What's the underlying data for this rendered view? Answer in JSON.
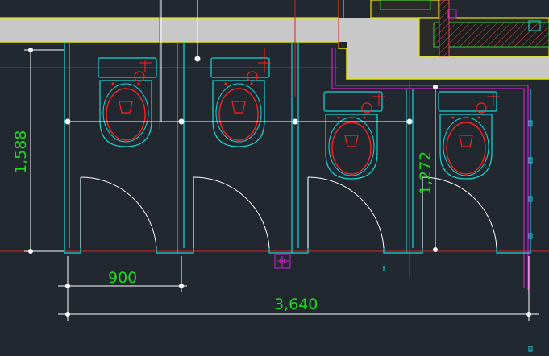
{
  "viewport": {
    "background": "#212830",
    "wall_fill": "#c8c8c8",
    "hatch_fill": "#b0b0b0"
  },
  "colors": {
    "partition": "#19d6d6",
    "wall_outline": "#e6e600",
    "fixture": "#ff2020",
    "door_swing": "#ffffff",
    "grid_line": "#e02020",
    "dimension": "#ffffff",
    "dimension_text": "#1fd81f",
    "magenta": "#d020d0"
  },
  "dimensions": {
    "stall_height_left": "1,588",
    "stall_height_right": "1,272",
    "stall_width": "900",
    "overall_width": "3,640"
  },
  "blocks": {
    "toilet_count": "4",
    "floor_drain_icon": "floor-drain-icon",
    "toilet_icon": "toilet-icon",
    "door_icon": "door-swing-icon"
  }
}
